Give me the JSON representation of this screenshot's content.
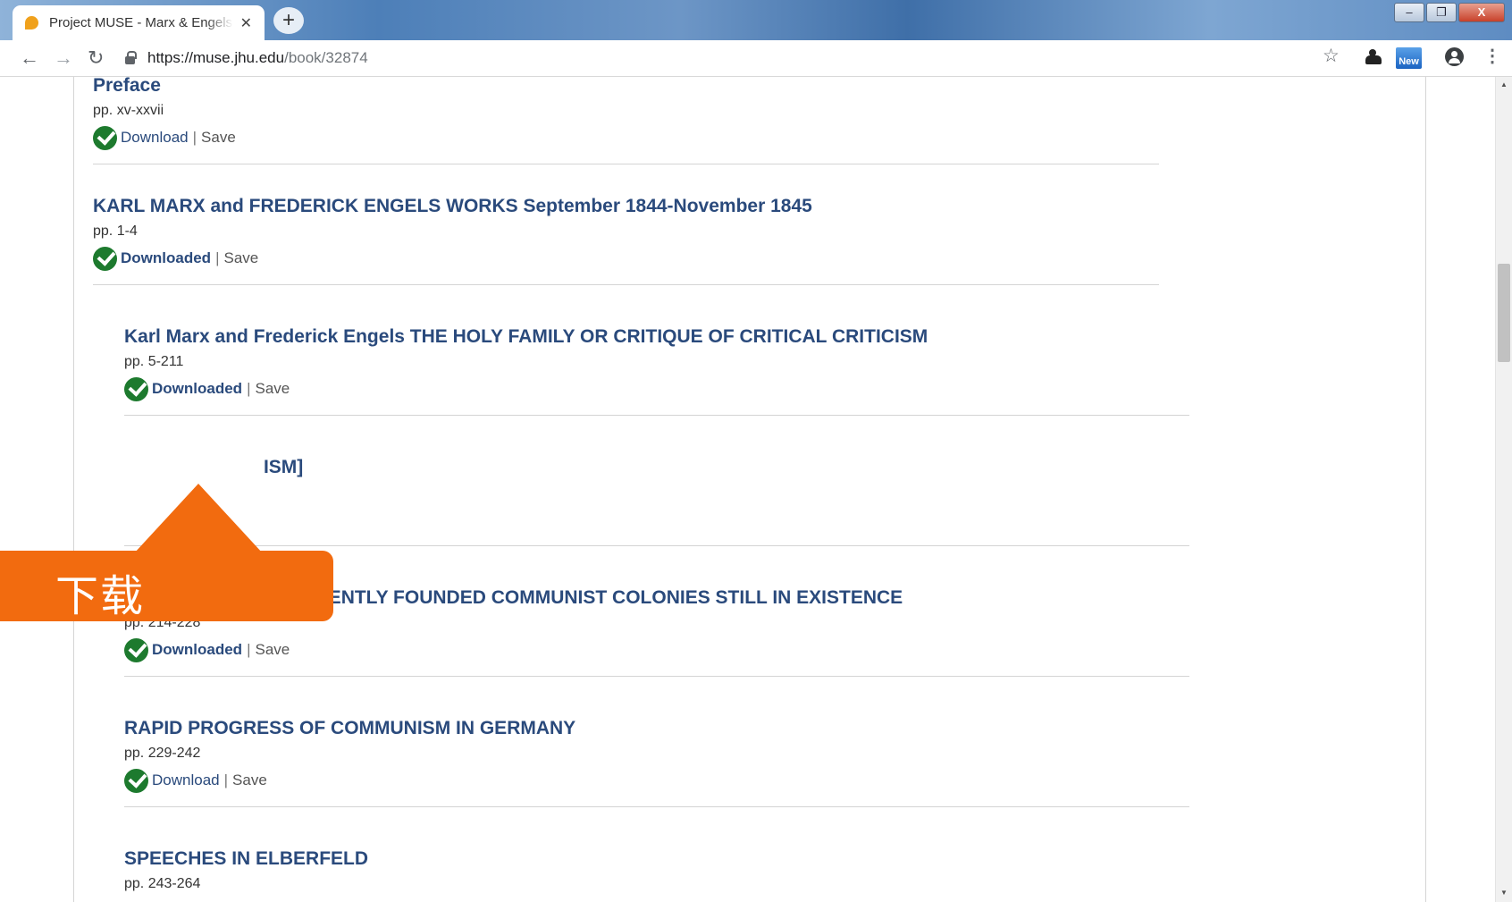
{
  "browser": {
    "tab_title": "Project MUSE - Marx & Engels",
    "tab_close": "✕",
    "new_tab": "+",
    "url_host": "https://muse.jhu.edu",
    "url_path": "/book/32874",
    "new_badge": "New",
    "window_buttons": [
      "–",
      "❐",
      "X"
    ]
  },
  "icons": {
    "back": "←",
    "forward": "→",
    "reload": "↻",
    "bookmark": "☆",
    "menu": "⋮",
    "scroll_up": "▲",
    "scroll_down": "▼"
  },
  "entries": [
    {
      "title": "Preface",
      "pages": "pp. xv-xxvii",
      "download": "Download",
      "downloaded": false,
      "separator": "|",
      "save": "Save"
    },
    {
      "title": "KARL MARX and FREDERICK ENGELS WORKS September 1844-November 1845",
      "pages": "pp. 1-4",
      "download": "Downloaded",
      "downloaded": true,
      "separator": "|",
      "save": "Save"
    },
    {
      "title": "Karl Marx and Frederick Engels THE HOLY FAMILY OR CRITIQUE OF CRITICAL CRITICISM",
      "pages": "pp. 5-211",
      "download": "Downloaded",
      "downloaded": true,
      "separator": "|",
      "save": "Save"
    },
    {
      "title": "[C...L SOCIALISM]",
      "title_visible_end": "ISM]",
      "pages": "",
      "download": "",
      "downloaded": true,
      "separator": "",
      "save": ""
    },
    {
      "title": "DESCRIPTION OF RECENTLY FOUNDED COMMUNIST COLONIES STILL IN EXISTENCE",
      "pages": "pp. 214-228",
      "download": "Downloaded",
      "downloaded": true,
      "separator": "|",
      "save": "Save"
    },
    {
      "title": "RAPID PROGRESS OF COMMUNISM IN GERMANY",
      "pages": "pp. 229-242",
      "download": "Download",
      "downloaded": false,
      "separator": "|",
      "save": "Save"
    },
    {
      "title": "SPEECHES IN ELBERFELD",
      "pages": "pp. 243-264",
      "download": "",
      "downloaded": false,
      "separator": "",
      "save": ""
    }
  ],
  "callout": {
    "text": "下载",
    "color": "#f26b0f"
  },
  "colors": {
    "link": "#2a4a7c",
    "check": "#1d7a2e"
  }
}
